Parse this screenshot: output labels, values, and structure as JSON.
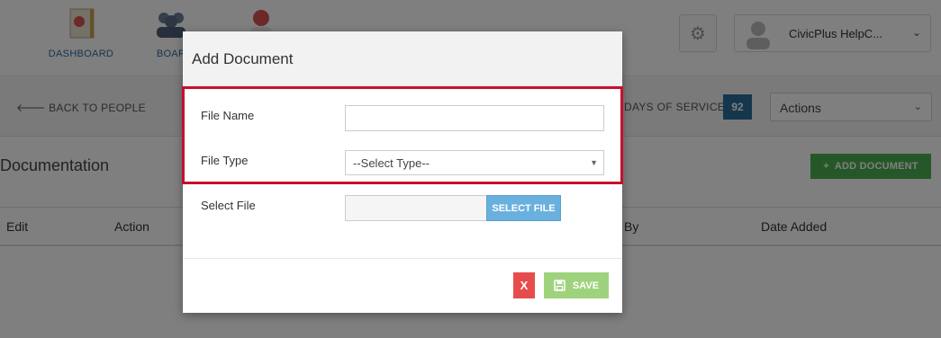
{
  "nav": {
    "items": [
      {
        "label": "DASHBOARD",
        "icon": "dashboard-icon"
      },
      {
        "label": "BOAR",
        "icon": "boards-icon"
      },
      {
        "label": "",
        "icon": "people-icon"
      }
    ]
  },
  "user": {
    "name": "CivicPlus HelpC...",
    "avatar_icon": "avatar-icon"
  },
  "settings_icon": "gear-icon",
  "subbar": {
    "back_label": "BACK TO PEOPLE",
    "days_label": "DAYS OF SERVICE",
    "days_value": "92",
    "actions_label": "Actions"
  },
  "section": {
    "title": "Documentation",
    "add_button": "ADD DOCUMENT"
  },
  "table": {
    "headers": [
      "Edit",
      "Action",
      "By",
      "Date Added"
    ]
  },
  "modal": {
    "title": "Add Document",
    "file_name_label": "File Name",
    "file_name_value": "",
    "file_type_label": "File Type",
    "file_type_value": "--Select Type--",
    "select_file_label": "Select File",
    "select_file_button": "SELECT FILE",
    "close_button": "X",
    "save_button": "SAVE"
  },
  "colors": {
    "highlight": "#c8102e",
    "accent_blue": "#2a6f9b",
    "save_green": "#9fd27d",
    "close_red": "#e74c4c",
    "add_green": "#4caf50"
  }
}
